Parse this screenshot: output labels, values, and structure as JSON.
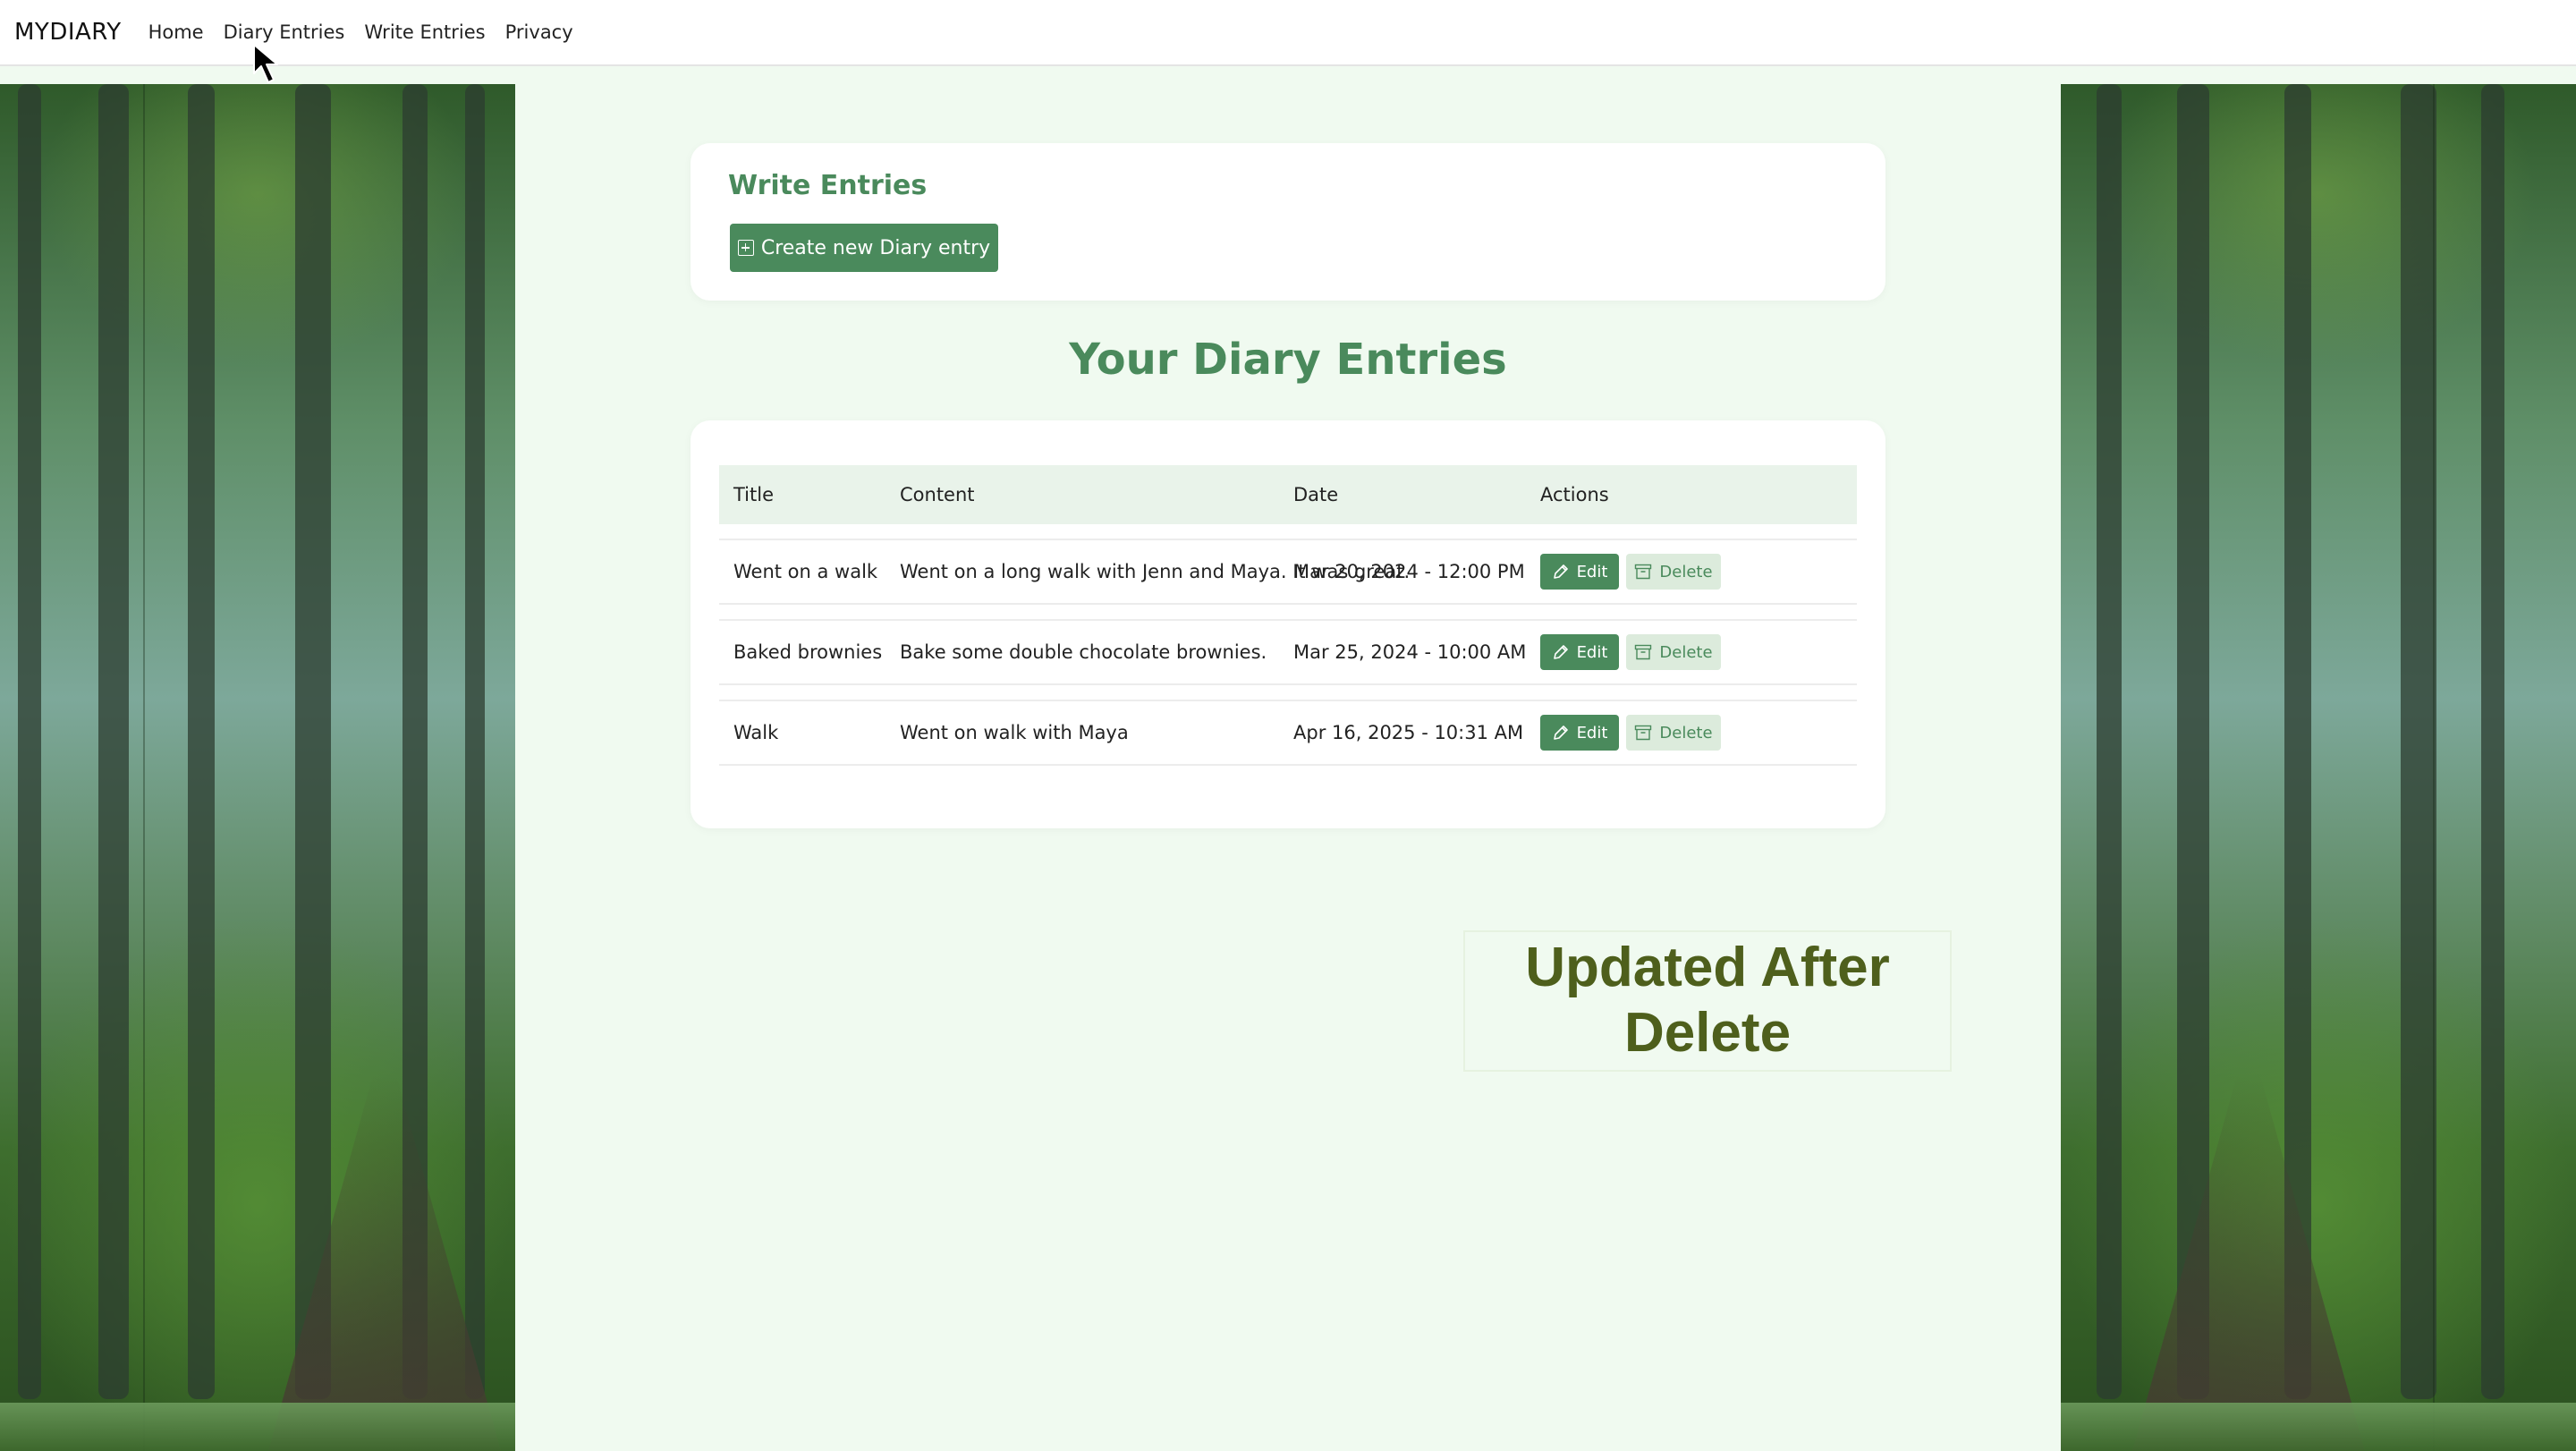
{
  "nav": {
    "brand": "MYDIARY",
    "links": [
      "Home",
      "Diary Entries",
      "Write Entries",
      "Privacy"
    ]
  },
  "write": {
    "title": "Write Entries",
    "create_label": "Create new Diary entry"
  },
  "entries": {
    "heading": "Your Diary Entries",
    "columns": [
      "Title",
      "Content",
      "Date",
      "Actions"
    ],
    "rows": [
      {
        "title": "Went on a walk",
        "content": "Went on a long walk with Jenn and Maya. It was great.",
        "date": "Mar 20, 2024 - 12:00 PM"
      },
      {
        "title": "Baked brownies",
        "content": "Bake some double chocolate brownies.",
        "date": "Mar 25, 2024 - 10:00 AM"
      },
      {
        "title": "Walk",
        "content": "Went on walk with Maya",
        "date": "Apr 16, 2025 - 10:31 AM"
      }
    ],
    "edit_label": "Edit",
    "delete_label": "Delete"
  },
  "notice": "Updated After Delete",
  "colors": {
    "accent": "#4a8a5c",
    "page_background": "#f0faf0",
    "notice_text": "#4e5f1c"
  }
}
